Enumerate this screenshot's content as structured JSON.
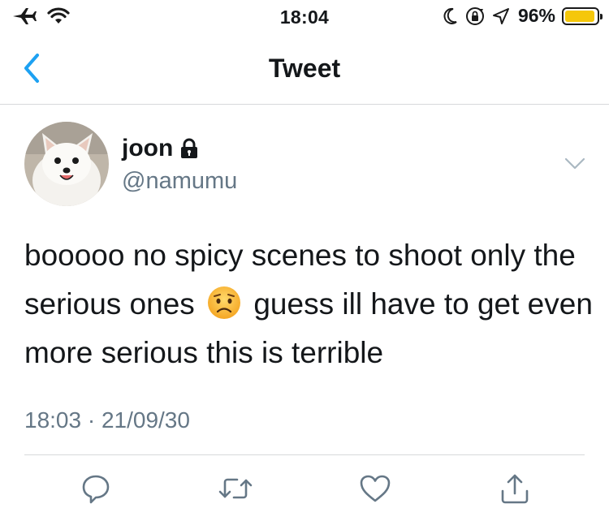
{
  "status_bar": {
    "time": "18:04",
    "battery_percent": "96%",
    "battery_level": 0.96,
    "battery_color": "#f5c70a",
    "icons": [
      "airplane-icon",
      "wifi-icon",
      "moon-icon",
      "rotation-lock-icon",
      "location-icon"
    ]
  },
  "nav": {
    "title": "Tweet",
    "back_icon": "chevron-left-icon",
    "accent_color": "#1da1f2"
  },
  "tweet": {
    "display_name": "joon",
    "protected_icon": "lock-icon",
    "handle": "@namumu",
    "text_before_emoji": "booooo no spicy scenes to shoot only the serious ones",
    "emoji": "worried-face-icon",
    "text_after_emoji": "guess ill have to get even more serious this is terrible",
    "timestamp": "18:03 · 21/09/30",
    "menu_icon": "chevron-down-icon"
  },
  "actions": [
    {
      "name": "reply",
      "icon": "reply-icon"
    },
    {
      "name": "retweet",
      "icon": "retweet-icon"
    },
    {
      "name": "like",
      "icon": "heart-icon"
    },
    {
      "name": "share",
      "icon": "share-icon"
    }
  ],
  "colors": {
    "text": "#14171a",
    "secondary_text": "#657786",
    "divider": "#d7d9db",
    "icon_gray": "#657786"
  }
}
